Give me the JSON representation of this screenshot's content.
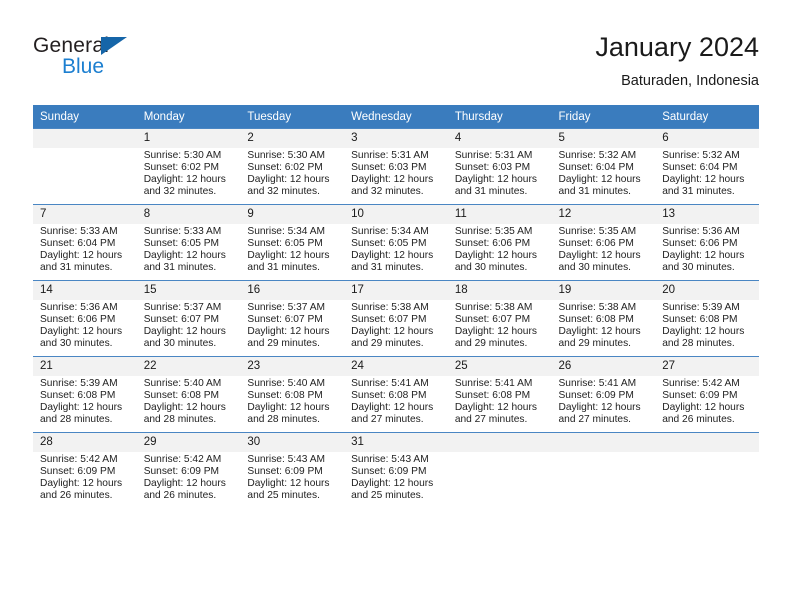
{
  "brand": {
    "line1": "General",
    "line2": "Blue",
    "flag_color": "#1565a8",
    "blue_color": "#1c7fd0"
  },
  "header": {
    "title": "January 2024",
    "subtitle": "Baturaden, Indonesia"
  },
  "theme": {
    "header_row_bg": "#3a7cbe",
    "daynum_bg": "#f2f2f2",
    "grid_line": "#4a86c3"
  },
  "weekdays": [
    "Sunday",
    "Monday",
    "Tuesday",
    "Wednesday",
    "Thursday",
    "Friday",
    "Saturday"
  ],
  "weeks": [
    [
      {
        "day": "",
        "sunrise": "",
        "sunset": "",
        "daylight": "",
        "empty": true
      },
      {
        "day": "1",
        "sunrise": "Sunrise: 5:30 AM",
        "sunset": "Sunset: 6:02 PM",
        "daylight": "Daylight: 12 hours and 32 minutes."
      },
      {
        "day": "2",
        "sunrise": "Sunrise: 5:30 AM",
        "sunset": "Sunset: 6:02 PM",
        "daylight": "Daylight: 12 hours and 32 minutes."
      },
      {
        "day": "3",
        "sunrise": "Sunrise: 5:31 AM",
        "sunset": "Sunset: 6:03 PM",
        "daylight": "Daylight: 12 hours and 32 minutes."
      },
      {
        "day": "4",
        "sunrise": "Sunrise: 5:31 AM",
        "sunset": "Sunset: 6:03 PM",
        "daylight": "Daylight: 12 hours and 31 minutes."
      },
      {
        "day": "5",
        "sunrise": "Sunrise: 5:32 AM",
        "sunset": "Sunset: 6:04 PM",
        "daylight": "Daylight: 12 hours and 31 minutes."
      },
      {
        "day": "6",
        "sunrise": "Sunrise: 5:32 AM",
        "sunset": "Sunset: 6:04 PM",
        "daylight": "Daylight: 12 hours and 31 minutes."
      }
    ],
    [
      {
        "day": "7",
        "sunrise": "Sunrise: 5:33 AM",
        "sunset": "Sunset: 6:04 PM",
        "daylight": "Daylight: 12 hours and 31 minutes."
      },
      {
        "day": "8",
        "sunrise": "Sunrise: 5:33 AM",
        "sunset": "Sunset: 6:05 PM",
        "daylight": "Daylight: 12 hours and 31 minutes."
      },
      {
        "day": "9",
        "sunrise": "Sunrise: 5:34 AM",
        "sunset": "Sunset: 6:05 PM",
        "daylight": "Daylight: 12 hours and 31 minutes."
      },
      {
        "day": "10",
        "sunrise": "Sunrise: 5:34 AM",
        "sunset": "Sunset: 6:05 PM",
        "daylight": "Daylight: 12 hours and 31 minutes."
      },
      {
        "day": "11",
        "sunrise": "Sunrise: 5:35 AM",
        "sunset": "Sunset: 6:06 PM",
        "daylight": "Daylight: 12 hours and 30 minutes."
      },
      {
        "day": "12",
        "sunrise": "Sunrise: 5:35 AM",
        "sunset": "Sunset: 6:06 PM",
        "daylight": "Daylight: 12 hours and 30 minutes."
      },
      {
        "day": "13",
        "sunrise": "Sunrise: 5:36 AM",
        "sunset": "Sunset: 6:06 PM",
        "daylight": "Daylight: 12 hours and 30 minutes."
      }
    ],
    [
      {
        "day": "14",
        "sunrise": "Sunrise: 5:36 AM",
        "sunset": "Sunset: 6:06 PM",
        "daylight": "Daylight: 12 hours and 30 minutes."
      },
      {
        "day": "15",
        "sunrise": "Sunrise: 5:37 AM",
        "sunset": "Sunset: 6:07 PM",
        "daylight": "Daylight: 12 hours and 30 minutes."
      },
      {
        "day": "16",
        "sunrise": "Sunrise: 5:37 AM",
        "sunset": "Sunset: 6:07 PM",
        "daylight": "Daylight: 12 hours and 29 minutes."
      },
      {
        "day": "17",
        "sunrise": "Sunrise: 5:38 AM",
        "sunset": "Sunset: 6:07 PM",
        "daylight": "Daylight: 12 hours and 29 minutes."
      },
      {
        "day": "18",
        "sunrise": "Sunrise: 5:38 AM",
        "sunset": "Sunset: 6:07 PM",
        "daylight": "Daylight: 12 hours and 29 minutes."
      },
      {
        "day": "19",
        "sunrise": "Sunrise: 5:38 AM",
        "sunset": "Sunset: 6:08 PM",
        "daylight": "Daylight: 12 hours and 29 minutes."
      },
      {
        "day": "20",
        "sunrise": "Sunrise: 5:39 AM",
        "sunset": "Sunset: 6:08 PM",
        "daylight": "Daylight: 12 hours and 28 minutes."
      }
    ],
    [
      {
        "day": "21",
        "sunrise": "Sunrise: 5:39 AM",
        "sunset": "Sunset: 6:08 PM",
        "daylight": "Daylight: 12 hours and 28 minutes."
      },
      {
        "day": "22",
        "sunrise": "Sunrise: 5:40 AM",
        "sunset": "Sunset: 6:08 PM",
        "daylight": "Daylight: 12 hours and 28 minutes."
      },
      {
        "day": "23",
        "sunrise": "Sunrise: 5:40 AM",
        "sunset": "Sunset: 6:08 PM",
        "daylight": "Daylight: 12 hours and 28 minutes."
      },
      {
        "day": "24",
        "sunrise": "Sunrise: 5:41 AM",
        "sunset": "Sunset: 6:08 PM",
        "daylight": "Daylight: 12 hours and 27 minutes."
      },
      {
        "day": "25",
        "sunrise": "Sunrise: 5:41 AM",
        "sunset": "Sunset: 6:08 PM",
        "daylight": "Daylight: 12 hours and 27 minutes."
      },
      {
        "day": "26",
        "sunrise": "Sunrise: 5:41 AM",
        "sunset": "Sunset: 6:09 PM",
        "daylight": "Daylight: 12 hours and 27 minutes."
      },
      {
        "day": "27",
        "sunrise": "Sunrise: 5:42 AM",
        "sunset": "Sunset: 6:09 PM",
        "daylight": "Daylight: 12 hours and 26 minutes."
      }
    ],
    [
      {
        "day": "28",
        "sunrise": "Sunrise: 5:42 AM",
        "sunset": "Sunset: 6:09 PM",
        "daylight": "Daylight: 12 hours and 26 minutes."
      },
      {
        "day": "29",
        "sunrise": "Sunrise: 5:42 AM",
        "sunset": "Sunset: 6:09 PM",
        "daylight": "Daylight: 12 hours and 26 minutes."
      },
      {
        "day": "30",
        "sunrise": "Sunrise: 5:43 AM",
        "sunset": "Sunset: 6:09 PM",
        "daylight": "Daylight: 12 hours and 25 minutes."
      },
      {
        "day": "31",
        "sunrise": "Sunrise: 5:43 AM",
        "sunset": "Sunset: 6:09 PM",
        "daylight": "Daylight: 12 hours and 25 minutes."
      },
      {
        "day": "",
        "sunrise": "",
        "sunset": "",
        "daylight": "",
        "empty": true
      },
      {
        "day": "",
        "sunrise": "",
        "sunset": "",
        "daylight": "",
        "empty": true
      },
      {
        "day": "",
        "sunrise": "",
        "sunset": "",
        "daylight": "",
        "empty": true
      }
    ]
  ]
}
